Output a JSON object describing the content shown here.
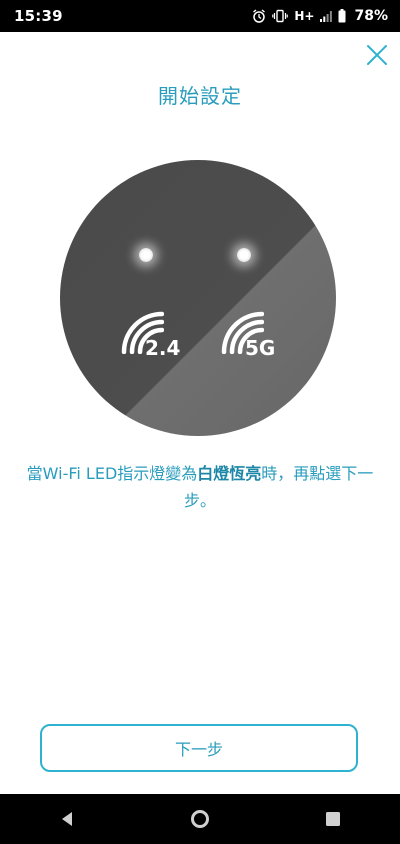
{
  "status_bar": {
    "time": "15:39",
    "network": "H+",
    "battery": "78%"
  },
  "header": {
    "title": "開始設定",
    "close_icon": "close-icon"
  },
  "device": {
    "band_24_label": "2.4",
    "band_5g_label": "5G",
    "led_color": "#ffffff"
  },
  "instruction": {
    "part1": "當Wi-Fi LED指示燈變為",
    "emphasis": "白燈恆亮",
    "part2": "時，再點選下一步。"
  },
  "actions": {
    "next_label": "下一步"
  },
  "colors": {
    "accent": "#2a9dbd",
    "button_border": "#2fb2cf"
  }
}
